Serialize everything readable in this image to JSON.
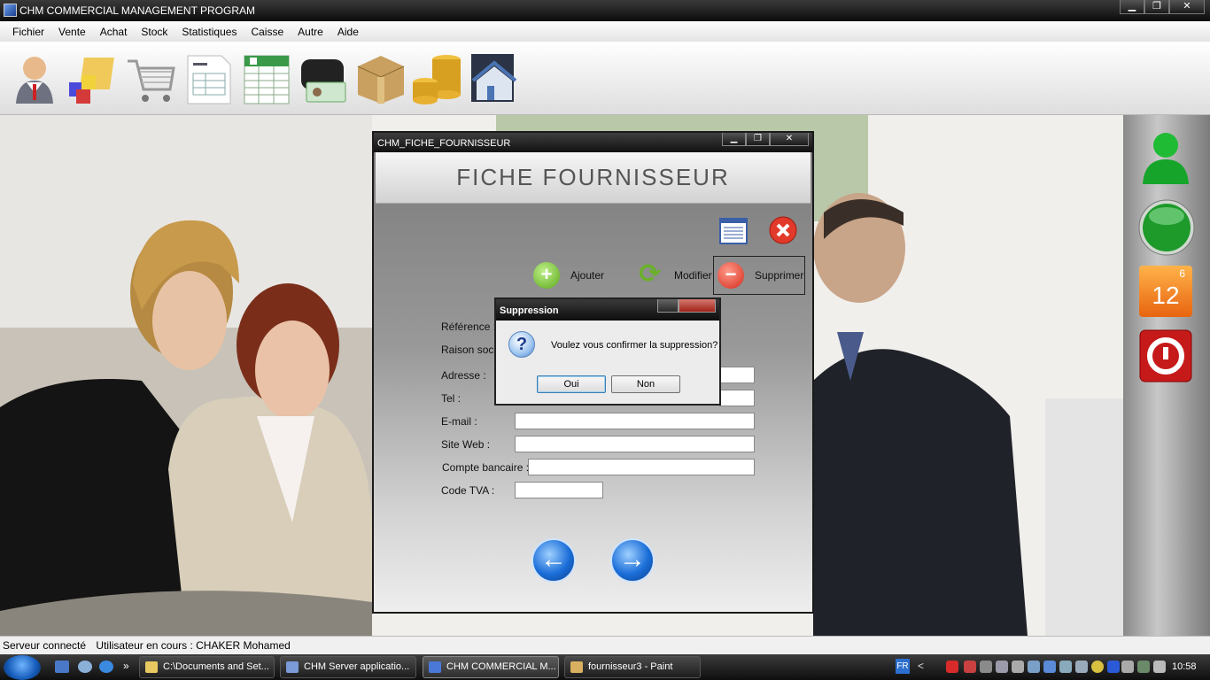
{
  "window": {
    "title": "CHM COMMERCIAL MANAGEMENT PROGRAM",
    "minimize": "▁",
    "maximize": "❐",
    "close": "✕"
  },
  "menu": [
    "Fichier",
    "Vente",
    "Achat",
    "Stock",
    "Statistiques",
    "Caisse",
    "Autre",
    "Aide"
  ],
  "toolbar_icons": [
    "user-icon",
    "cubes-folder-icon",
    "shopping-cart-icon",
    "invoice-icon",
    "spreadsheet-icon",
    "wallet-card-icon",
    "box-icon",
    "coins-icon",
    "house-icon"
  ],
  "sidepanel": {
    "calendar_day": "12",
    "calendar_small": "6"
  },
  "dialog": {
    "title": "CHM_FICHE_FOURNISSEUR",
    "banner": "FICHE FOURNISSEUR",
    "actions": {
      "add": "Ajouter",
      "edit": "Modifier",
      "delete": "Supprimer"
    },
    "labels": {
      "reference": "Référence :",
      "raison": "Raison socia",
      "adresse": "Adresse :",
      "tel": "Tel :",
      "email": "E-mail :",
      "site": "Site Web :",
      "compte": "Compte bancaire :",
      "tva": "Code TVA :"
    }
  },
  "msgbox": {
    "title": "Suppression",
    "text": "Voulez vous confirmer la suppression?",
    "yes": "Oui",
    "no": "Non"
  },
  "status": {
    "server": "Serveur connecté",
    "user": "Utilisateur en cours : CHAKER Mohamed"
  },
  "taskbar": {
    "tasks": [
      "C:\\Documents and Set...",
      "CHM Server applicatio...",
      "CHM COMMERCIAL M...",
      "fournisseur3 - Paint"
    ],
    "lang": "FR",
    "clock": "10:58",
    "expand": "»",
    "hidden": "<"
  }
}
